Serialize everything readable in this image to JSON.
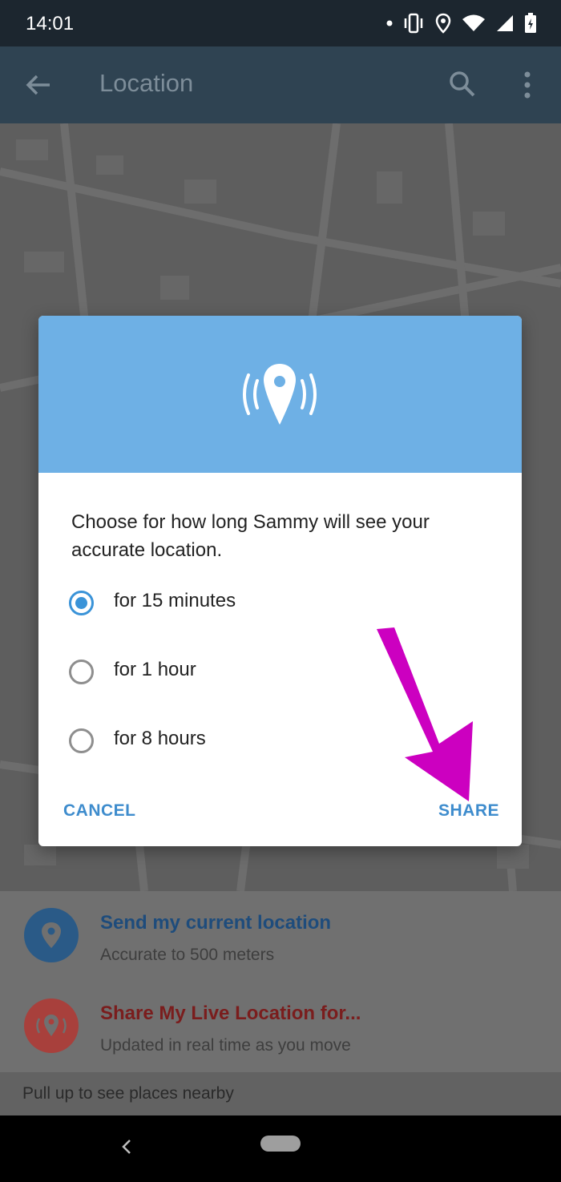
{
  "status_bar": {
    "time": "14:01",
    "icons": [
      "notification-dot-icon",
      "vibrate-icon",
      "location-icon",
      "wifi-icon",
      "signal-icon",
      "battery-icon"
    ]
  },
  "app_bar": {
    "title": "Location",
    "icons": [
      "back-arrow-icon",
      "search-icon",
      "more-vert-icon"
    ]
  },
  "dialog": {
    "header_icon": "live-location-icon",
    "header_color": "#6eb0e5",
    "message": "Choose for how long Sammy will see your accurate location.",
    "options": [
      {
        "label": "for 15 minutes",
        "selected": true
      },
      {
        "label": "for 1 hour",
        "selected": false
      },
      {
        "label": "for 8 hours",
        "selected": false
      }
    ],
    "cancel_label": "CANCEL",
    "share_label": "SHARE",
    "accent_color": "#3a93d8"
  },
  "bottom_panel": {
    "current_location": {
      "title": "Send my current location",
      "subtitle": "Accurate to 500 meters",
      "color": "#2a5a87"
    },
    "live_location": {
      "title": "Share My Live Location for...",
      "subtitle": "Updated in real time as you move",
      "color": "#a8403c"
    },
    "pull_hint": "Pull up to see places nearby"
  },
  "annotation": {
    "arrow_color": "#cc00c0",
    "points_to": "share-button"
  }
}
